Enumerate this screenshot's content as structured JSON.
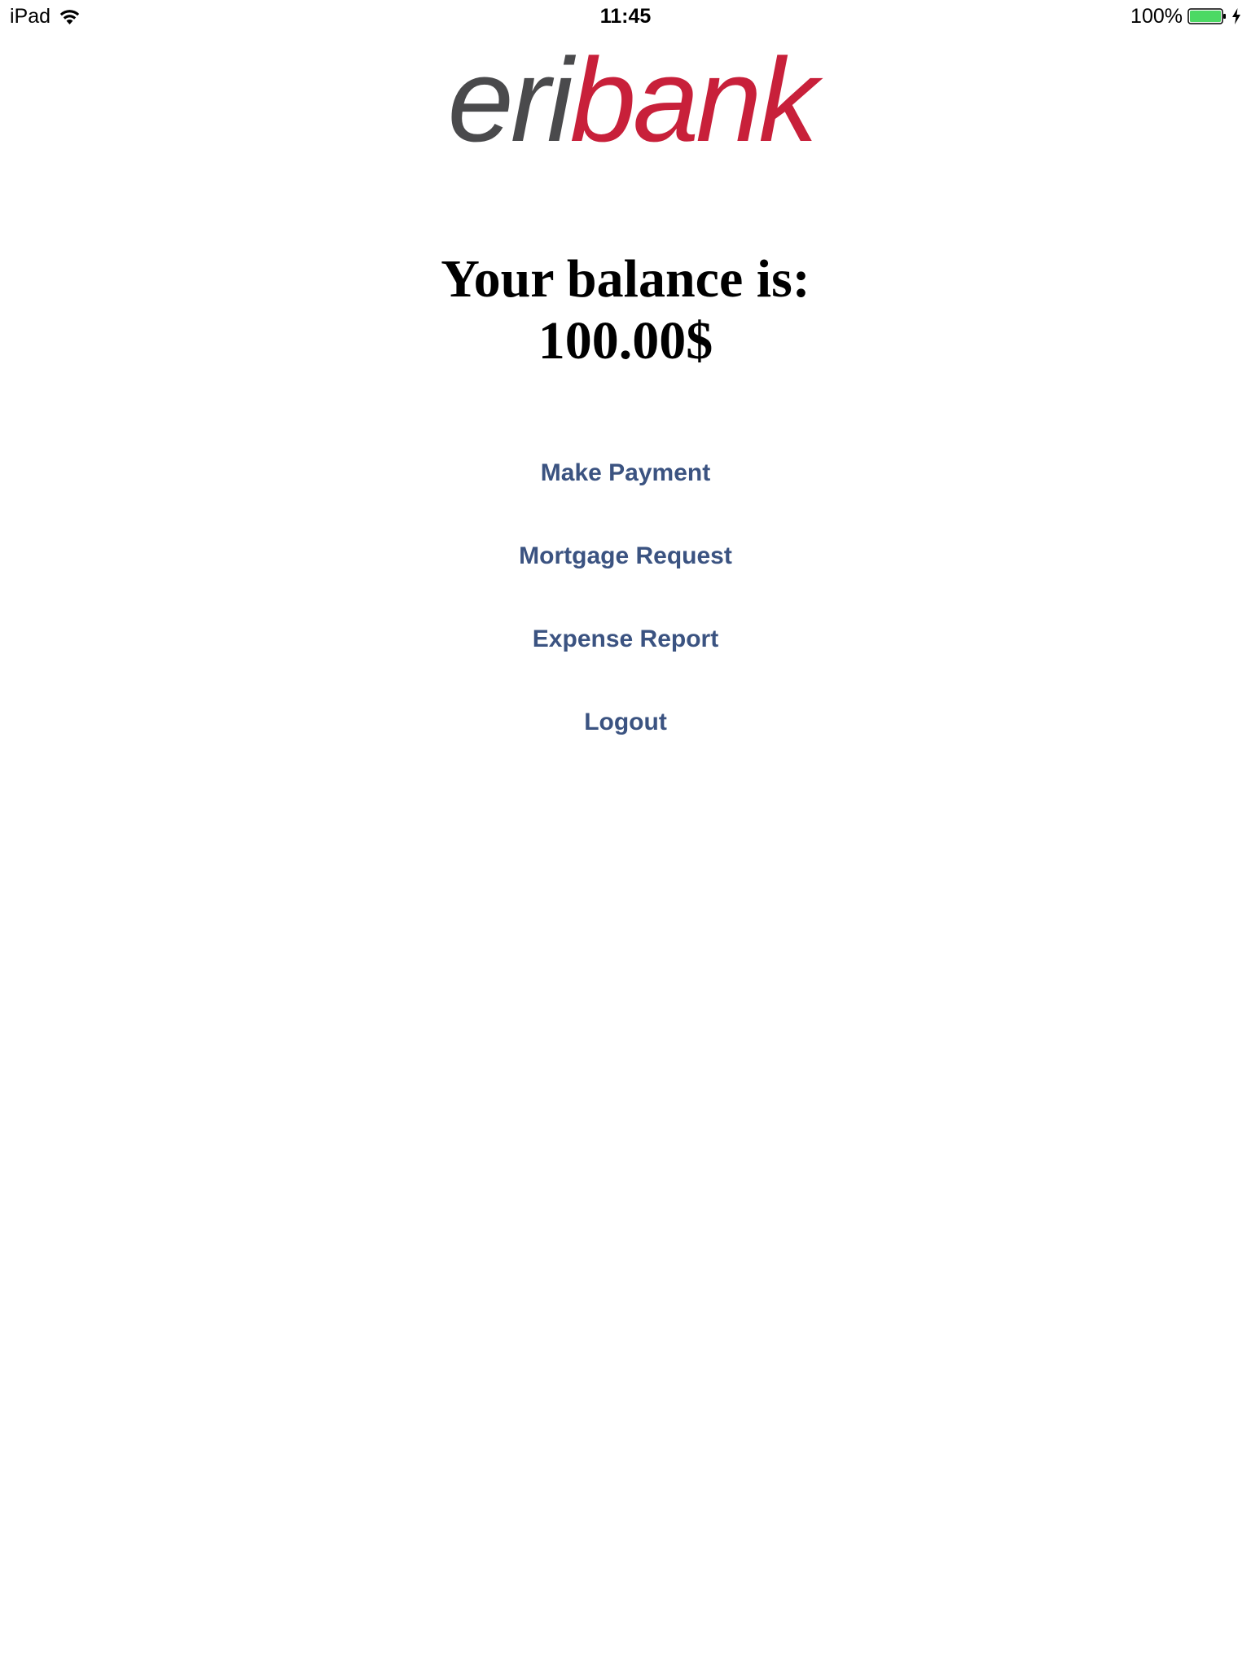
{
  "status_bar": {
    "device": "iPad",
    "time": "11:45",
    "battery": "100%",
    "battery_level": 1.0,
    "charging": true,
    "wifi_icon": "wifi-icon",
    "battery_icon": "battery-icon",
    "battery_color": "#4cd964"
  },
  "logo": {
    "part1": "eri",
    "part2": "bank",
    "color1": "#4a4a4c",
    "color2": "#c8203a"
  },
  "balance": {
    "label": "Your balance is:",
    "amount": "100.00$"
  },
  "menu": {
    "link_color": "#3b5381",
    "items": [
      {
        "label": "Make Payment"
      },
      {
        "label": "Mortgage Request"
      },
      {
        "label": "Expense Report"
      },
      {
        "label": "Logout"
      }
    ]
  }
}
